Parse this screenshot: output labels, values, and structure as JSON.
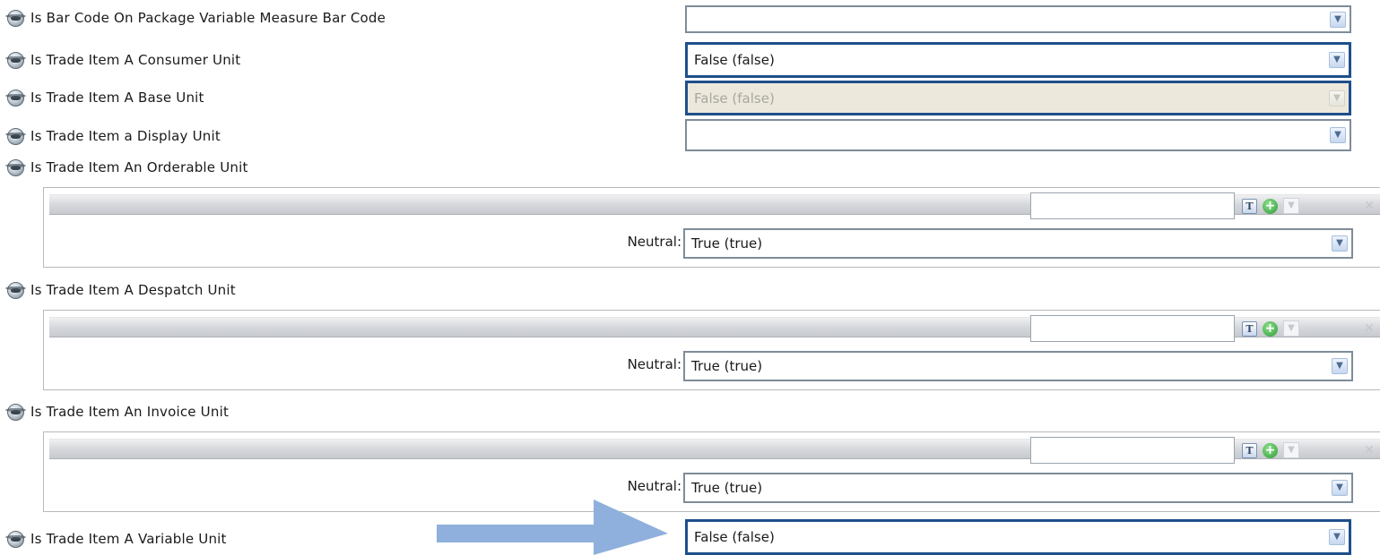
{
  "attributes": [
    {
      "label": "Is Bar Code On Package Variable Measure Bar Code",
      "value": "",
      "state": "normal"
    },
    {
      "label": "Is Trade Item A Consumer Unit",
      "value": "False (false)",
      "state": "focused"
    },
    {
      "label": "Is Trade Item A Base Unit",
      "value": "False (false)",
      "state": "disabled"
    },
    {
      "label": "Is Trade Item a Display Unit",
      "value": "",
      "state": "normal"
    }
  ],
  "groups": [
    {
      "label": "Is Trade Item An Orderable Unit",
      "search_value": "",
      "neutral_label": "Neutral:",
      "neutral_value": "True (true)"
    },
    {
      "label": "Is Trade Item A Despatch Unit",
      "search_value": "",
      "neutral_label": "Neutral:",
      "neutral_value": "True (true)"
    },
    {
      "label": "Is Trade Item An Invoice Unit",
      "search_value": "",
      "neutral_label": "Neutral:",
      "neutral_value": "True (true)"
    }
  ],
  "last_attribute": {
    "label": "Is Trade Item A Variable Unit",
    "value": "False (false)",
    "state": "focused"
  },
  "icons": {
    "attribute": "globe-icon",
    "dropdown": "chevron-down-icon",
    "filter": "filter-icon",
    "add": "add-icon",
    "remove": "remove-icon",
    "highlight": "arrow-icon"
  },
  "colors": {
    "focus_border": "#1e4f8a",
    "field_border": "#7f8c99",
    "disabled_bg": "#ece8dc",
    "arrow": "#8fb0dc",
    "add_green": "#2e9a34"
  }
}
